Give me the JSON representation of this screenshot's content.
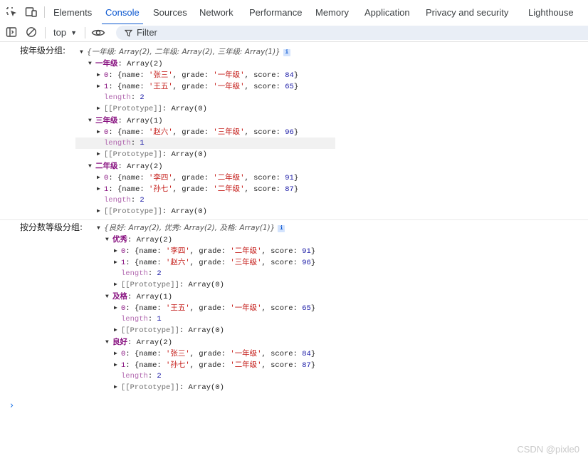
{
  "tabs": [
    {
      "label": "Elements",
      "active": false
    },
    {
      "label": "Console",
      "active": true
    },
    {
      "label": "Sources",
      "active": false
    },
    {
      "label": "Network",
      "active": false
    },
    {
      "label": "Performance",
      "active": false
    },
    {
      "label": "Memory",
      "active": false
    },
    {
      "label": "Application",
      "active": false
    },
    {
      "label": "Privacy and security",
      "active": false
    },
    {
      "label": "Lighthouse",
      "active": false
    }
  ],
  "toolbar": {
    "context": "top",
    "filter_placeholder": "Filter"
  },
  "colors": {
    "accent": "#0b57d0",
    "key": "#881280",
    "string": "#c41a16",
    "number": "#1a1aa6"
  },
  "logs": [
    {
      "label": "按年级分组:",
      "summary": "{一年级: Array(2), 二年级: Array(2), 三年级: Array(1)}",
      "groups": [
        {
          "key": "一年级",
          "type": "Array(2)",
          "items": [
            {
              "index": "0",
              "name": "张三",
              "grade": "一年级",
              "score": "84"
            },
            {
              "index": "1",
              "name": "王五",
              "grade": "一年级",
              "score": "65"
            }
          ],
          "length": "2",
          "proto": "Array(0)"
        },
        {
          "key": "三年级",
          "type": "Array(1)",
          "items": [
            {
              "index": "0",
              "name": "赵六",
              "grade": "三年级",
              "score": "96"
            }
          ],
          "length": "1",
          "proto": "Array(0)"
        },
        {
          "key": "二年级",
          "type": "Array(2)",
          "items": [
            {
              "index": "0",
              "name": "李四",
              "grade": "二年级",
              "score": "91"
            },
            {
              "index": "1",
              "name": "孙七",
              "grade": "二年级",
              "score": "87"
            }
          ],
          "length": "2",
          "proto": "Array(0)"
        }
      ]
    },
    {
      "label": "按分数等级分组:",
      "summary": "{良好: Array(2), 优秀: Array(2), 及格: Array(1)}",
      "groups": [
        {
          "key": "优秀",
          "type": "Array(2)",
          "items": [
            {
              "index": "0",
              "name": "李四",
              "grade": "二年级",
              "score": "91"
            },
            {
              "index": "1",
              "name": "赵六",
              "grade": "三年级",
              "score": "96"
            }
          ],
          "length": "2",
          "proto": "Array(0)"
        },
        {
          "key": "及格",
          "type": "Array(1)",
          "items": [
            {
              "index": "0",
              "name": "王五",
              "grade": "一年级",
              "score": "65"
            }
          ],
          "length": "1",
          "proto": "Array(0)"
        },
        {
          "key": "良好",
          "type": "Array(2)",
          "items": [
            {
              "index": "0",
              "name": "张三",
              "grade": "一年级",
              "score": "84"
            },
            {
              "index": "1",
              "name": "孙七",
              "grade": "二年级",
              "score": "87"
            }
          ],
          "length": "2",
          "proto": "Array(0)"
        }
      ]
    }
  ],
  "watermark": "CSDN @pixle0"
}
